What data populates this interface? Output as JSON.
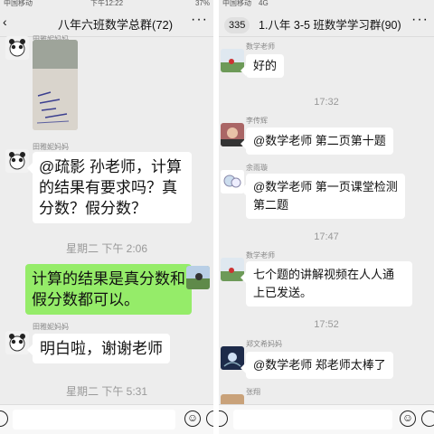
{
  "left": {
    "status": {
      "carrier": "中国移动",
      "time": "下午12:22",
      "battery": "37%"
    },
    "header": {
      "back_icon": "‹",
      "title": "八年六班数学总群(72)",
      "more_icon": "···"
    },
    "top_sender": "田雅妮妈妈",
    "messages": [
      {
        "sender": "田雅妮妈妈",
        "text": "@疏影 孙老师，计算的结果有要求吗？真分数？假分数？"
      },
      {
        "time": "星期二 下午 2:06"
      },
      {
        "sender": "me",
        "text": "计算的结果是真分数和假分数都可以。"
      },
      {
        "sender": "田雅妮妈妈",
        "text": "明白啦，谢谢老师"
      },
      {
        "time": "星期二 下午 5:31"
      }
    ],
    "bottom": {
      "voice_icon": "⊙",
      "emoji_icon": "☺",
      "plus_icon": "⊕"
    }
  },
  "right": {
    "status": {
      "carrier": "中国移动",
      "network": "4G"
    },
    "header": {
      "unread_badge": "335",
      "title": "1.八年 3-5 班数学学习群(90)",
      "more_icon": "···"
    },
    "messages": [
      {
        "sender": "数学老师",
        "text": "好的"
      },
      {
        "time": "17:32"
      },
      {
        "sender": "李传辉",
        "text": "@数学老师 第二页第十题"
      },
      {
        "sender": "余雨璇",
        "text": "@数学老师 第一页课堂检测第二题"
      },
      {
        "time": "17:47"
      },
      {
        "sender": "数学老师",
        "text": "七个题的讲解视频在人人通上已发送。"
      },
      {
        "time": "17:52"
      },
      {
        "sender": "郑文希妈妈",
        "text": "@数学老师 郑老师太棒了"
      },
      {
        "sender": "张翔"
      }
    ],
    "bottom": {
      "voice_icon": "⊙",
      "emoji_icon": "☺",
      "plus_icon": "⊕"
    }
  }
}
